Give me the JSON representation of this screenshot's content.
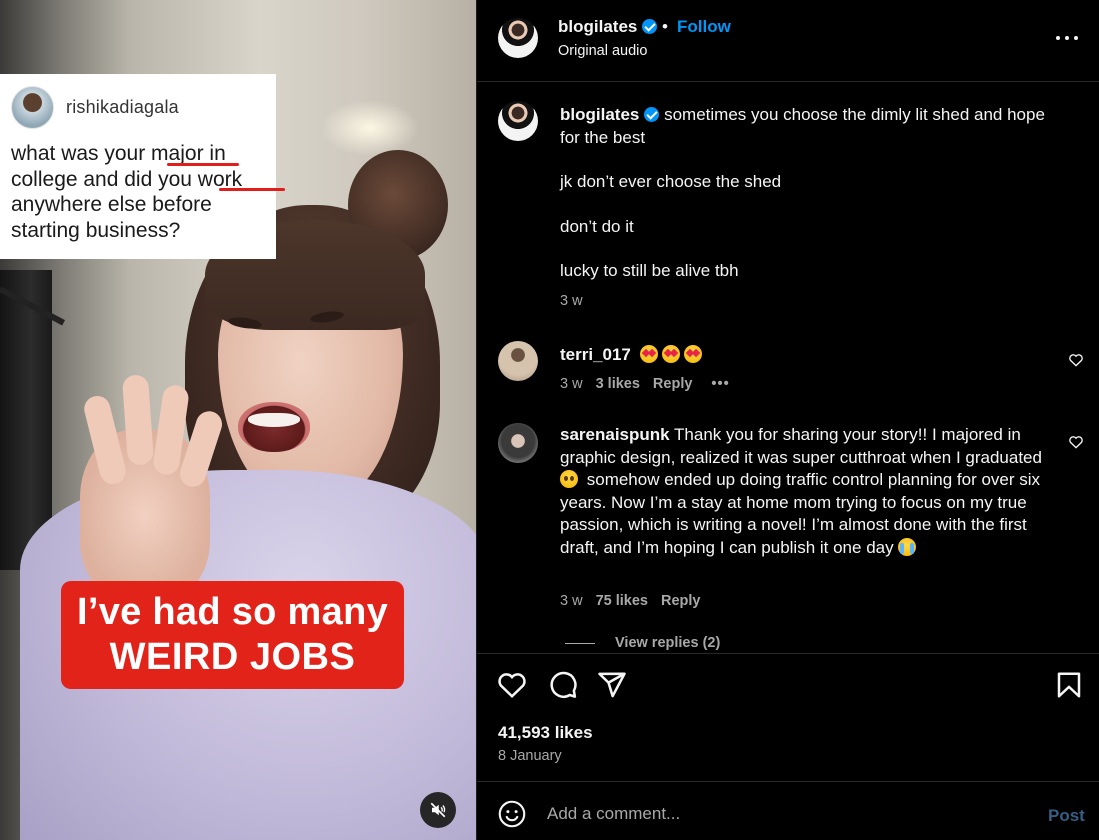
{
  "video": {
    "question_card": {
      "username": "rishikadiagala",
      "question": "what was your major in college and did you work anywhere else before starting business?"
    },
    "caption": {
      "line1": "I’ve had so many",
      "line2": "WEIRD JOBS"
    },
    "mute_icon": "speaker-muted-icon"
  },
  "post": {
    "username": "blogilates",
    "verified": true,
    "separator": "•",
    "follow_label": "Follow",
    "audio_label": "Original audio",
    "more_icon": "more-horizontal-icon"
  },
  "comments": [
    {
      "username": "blogilates",
      "verified": true,
      "paragraphs": [
        "sometimes you choose the dimly lit shed and hope for the best",
        "jk don’t ever choose the shed",
        "don’t do it",
        "lucky to still be alive tbh"
      ],
      "time": "3 w"
    },
    {
      "username": "terri_017",
      "text": "",
      "emojis": [
        "star-struck-emoji",
        "star-struck-emoji",
        "star-struck-emoji"
      ],
      "time": "3 w",
      "likes": "3 likes",
      "reply_label": "Reply",
      "options_label": "•••"
    },
    {
      "username": "sarenaispunk",
      "text_part1": "Thank you for sharing your story!! I majored in graphic design, realized it was super cutthroat when I graduated",
      "text_part2": "somehow ended up doing traffic control planning for over six years. Now I’m a stay at home mom trying to focus on my true passion, which is writing a novel! I’m almost done with the first draft, and I’m hoping I can publish it one day",
      "time": "3 w",
      "likes": "75 likes",
      "reply_label": "Reply",
      "view_replies": "View replies (2)"
    }
  ],
  "actions": {
    "likes": "41,593 likes",
    "date": "8 January",
    "icons": [
      "heart-icon",
      "comment-icon",
      "share-icon",
      "bookmark-icon"
    ]
  },
  "composer": {
    "placeholder": "Add a comment...",
    "post_label": "Post"
  },
  "colors": {
    "background": "#000000",
    "accent_blue": "#0095f6",
    "muted_text": "#a8a8a8",
    "post_disabled": "#365d82",
    "caption_red": "#e1231a"
  }
}
